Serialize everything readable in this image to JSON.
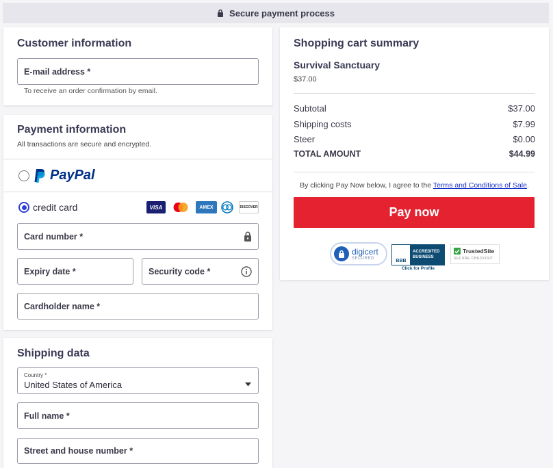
{
  "topbar": {
    "text": "Secure payment process",
    "icon": "lock-icon"
  },
  "customer": {
    "title": "Customer information",
    "email_label": "E-mail address *",
    "email_hint": "To receive an order confirmation by email."
  },
  "payment": {
    "title": "Payment information",
    "subtitle": "All transactions are secure and encrypted.",
    "paypal_label": "PayPal",
    "credit_label": "credit card",
    "card_brands": [
      "VISA",
      "mastercard",
      "AMEX",
      "diners",
      "DISCOVER"
    ],
    "card_number_label": "Card number *",
    "expiry_label": "Expiry date *",
    "security_label": "Security code *",
    "cardholder_label": "Cardholder name *"
  },
  "shipping": {
    "title": "Shipping data",
    "country_label": "Country *",
    "country_value": "United States of America",
    "fullname_label": "Full name *",
    "street_label": "Street and house number *"
  },
  "summary": {
    "title": "Shopping cart summary",
    "product_name": "Survival Sanctuary",
    "product_price": "$37.00",
    "rows": [
      {
        "label": "Subtotal",
        "value": "$37.00"
      },
      {
        "label": "Shipping costs",
        "value": "$7.99"
      },
      {
        "label": "Steer",
        "value": "$0.00"
      }
    ],
    "total_label": "TOTAL AMOUNT",
    "total_value": "$44.99",
    "terms_prefix": "By clicking Pay Now below, I agree to the",
    "terms_link": "Terms and Conditions of Sale",
    "terms_suffix": ".",
    "pay_button": "Pay now"
  },
  "badges": {
    "digicert_main": "digicert",
    "digicert_sub": "SECURED",
    "bbb_mark": "BBB",
    "bbb_line1": "ACCREDITED",
    "bbb_line2": "BUSINESS",
    "bbb_caption": "Click for Profile",
    "trusted_main": "TrustedSite",
    "trusted_sub": "SECURE CHECKOUT"
  },
  "colors": {
    "accent": "#2f3fd6",
    "pay_button": "#e52330",
    "paypal_dark": "#003087",
    "paypal_light": "#009cde"
  }
}
